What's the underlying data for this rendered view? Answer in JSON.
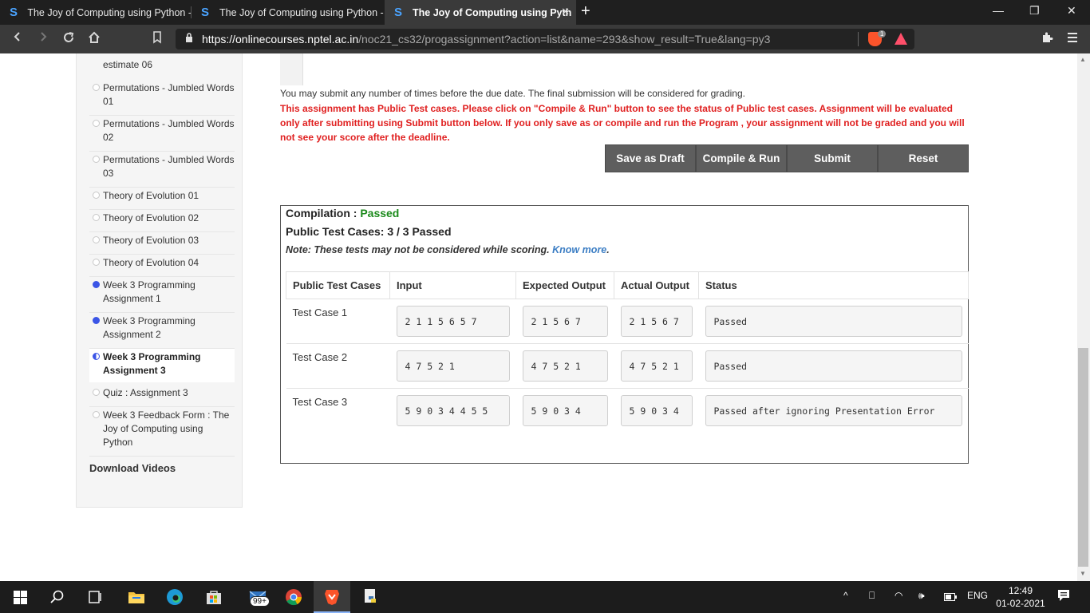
{
  "browser": {
    "tabs": [
      {
        "favicon": "S",
        "title": "The Joy of Computing using Python -"
      },
      {
        "favicon": "S",
        "title": "The Joy of Computing using Python -"
      },
      {
        "favicon": "S",
        "title": "The Joy of Computing using Pyth",
        "active": true
      }
    ],
    "new_tab": "+",
    "url_host": "https://onlinecourses.nptel.ac.in",
    "url_path": "/noc21_cs32/progassignment?action=list&name=293&show_result=True&lang=py3",
    "brave_badge": "1",
    "icons": [
      "back-icon",
      "forward-icon",
      "reload-icon",
      "home-icon",
      "bookmark-icon",
      "lock-icon",
      "brave-shield-icon",
      "bat-icon",
      "extensions-icon",
      "menu-icon"
    ]
  },
  "sidebar": {
    "cut_item": "estimate 06",
    "items": [
      {
        "label": "Permutations - Jumbled Words 01",
        "state": "none"
      },
      {
        "label": "Permutations - Jumbled Words 02",
        "state": "none"
      },
      {
        "label": "Permutations - Jumbled Words 03",
        "state": "none"
      },
      {
        "label": "Theory of Evolution 01",
        "state": "none"
      },
      {
        "label": "Theory of Evolution 02",
        "state": "none"
      },
      {
        "label": "Theory of Evolution 03",
        "state": "none"
      },
      {
        "label": "Theory of Evolution 04",
        "state": "none"
      },
      {
        "label": "Week 3 Programming Assignment 1",
        "state": "done"
      },
      {
        "label": "Week 3 Programming Assignment 2",
        "state": "done"
      },
      {
        "label": "Week 3 Programming Assignment 3",
        "state": "current"
      },
      {
        "label": "Quiz : Assignment 3",
        "state": "none"
      },
      {
        "label": "Week 3 Feedback Form : The Joy of Computing using Python",
        "state": "none"
      }
    ],
    "download_videos": "Download Videos"
  },
  "main": {
    "submit_note": "You may submit any number of times before the due date. The final submission will be considered for grading.",
    "warning": "This assignment has Public Test cases. Please click on \"Compile & Run\" button to see the status of Public test cases. Assignment will be evaluated only after submitting using Submit button below. If you only save as or compile and run the Program , your assignment will not be graded and you will not see your score after the deadline.",
    "buttons": {
      "save_draft": "Save as Draft",
      "compile_run": "Compile & Run",
      "submit": "Submit",
      "reset": "Reset"
    }
  },
  "result": {
    "compilation_label": "Compilation : ",
    "compilation_status": "Passed",
    "public_tests": "Public Test Cases: 3 / 3 Passed",
    "note": "Note: These tests may not be considered while scoring.",
    "know_more": "Know more",
    "note_end": ".",
    "columns": [
      "Public Test Cases",
      "Input",
      "Expected Output",
      "Actual Output",
      "Status"
    ],
    "rows": [
      {
        "name": "Test Case 1",
        "input": "2 1 1 5 6 5 7",
        "expected": "2 1 5 6 7",
        "actual": "2 1 5 6 7",
        "status": "Passed"
      },
      {
        "name": "Test Case 2",
        "input": "4 7 5 2 1",
        "expected": "4 7 5 2 1",
        "actual": "4 7 5 2 1",
        "status": "Passed"
      },
      {
        "name": "Test Case 3",
        "input": "5 9 0 3 4 4 5 5",
        "expected": "5 9 0 3 4",
        "actual": "5 9 0 3 4",
        "status": "Passed after ignoring Presentation Error"
      }
    ]
  },
  "taskbar": {
    "mail_badge": "99+",
    "language": "ENG",
    "time": "12:49",
    "date": "01-02-2021"
  }
}
